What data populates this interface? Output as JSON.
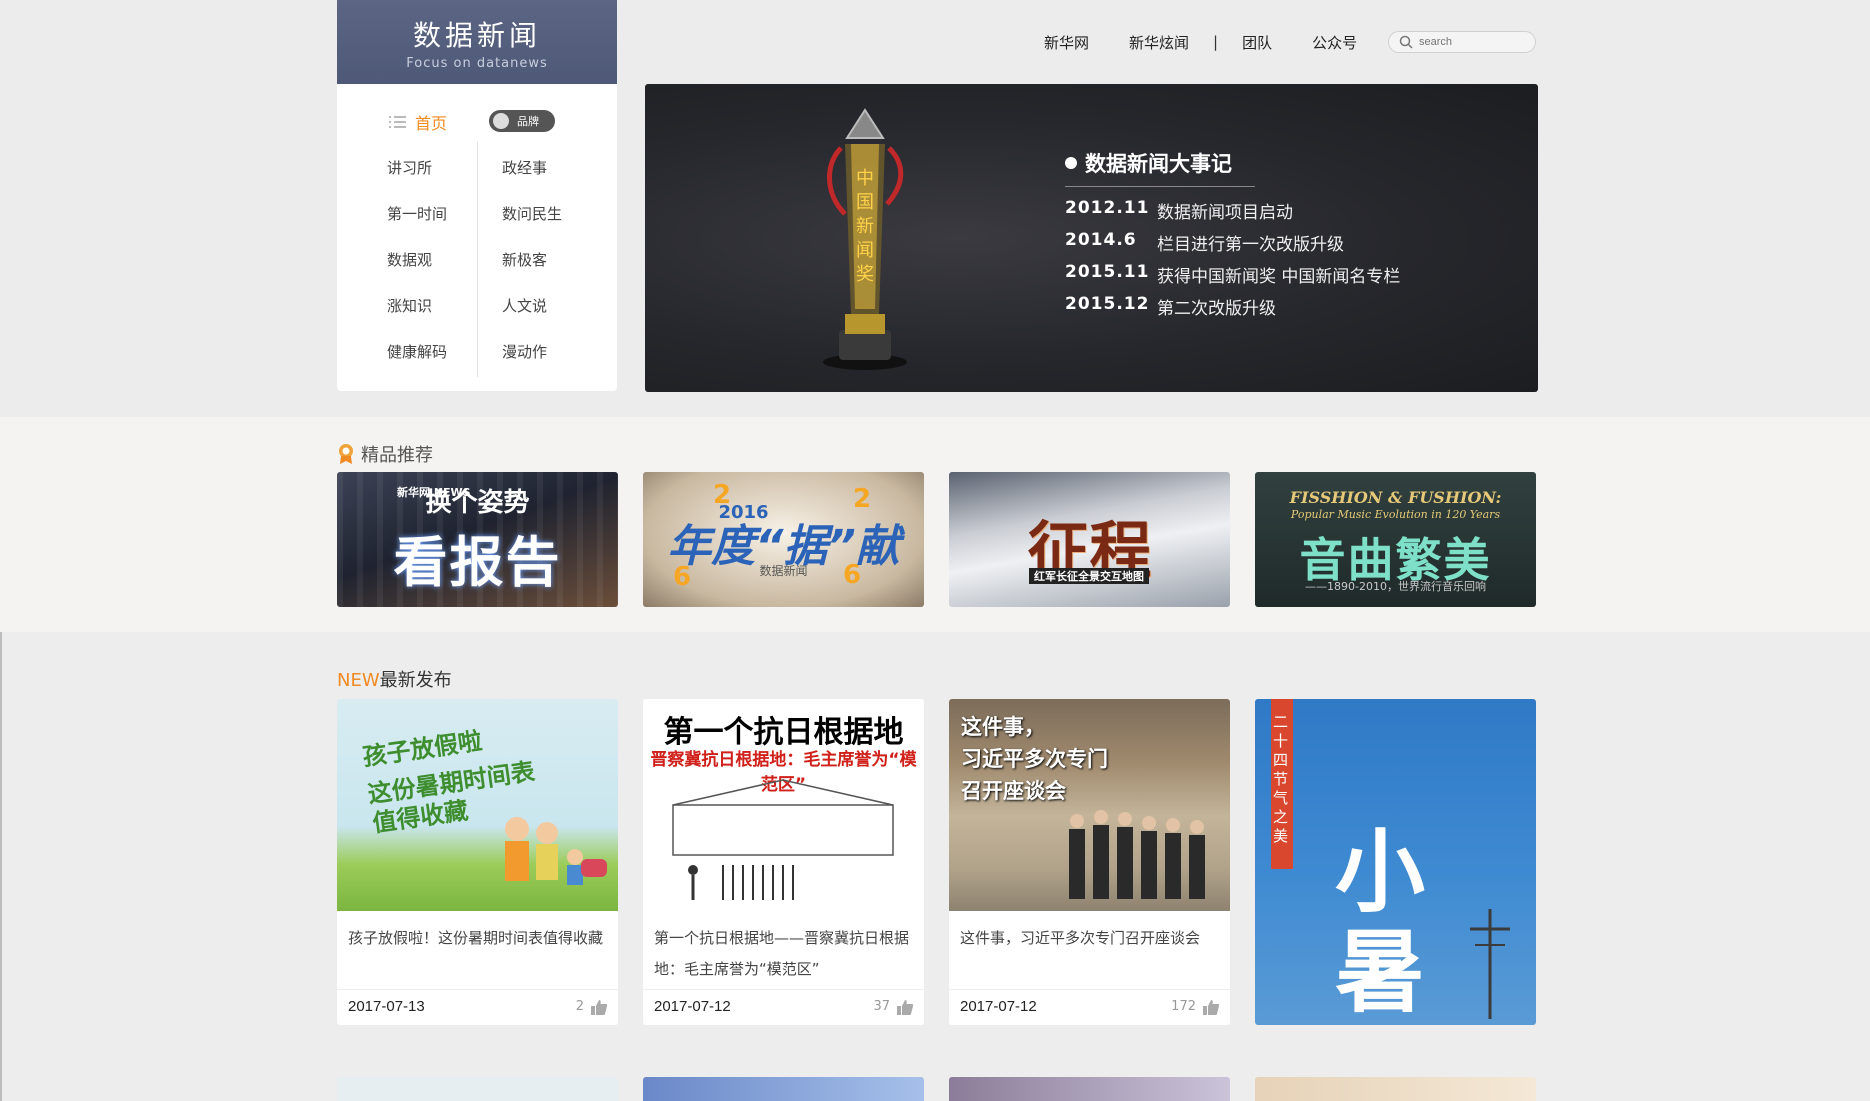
{
  "header": {
    "logo_cn": "数据新闻",
    "logo_en": "Focus on datanews",
    "nav": [
      "新华网",
      "新华炫闻",
      "团队",
      "公众号"
    ],
    "separator": "|",
    "search_placeholder": "search"
  },
  "menu": {
    "home": "首页",
    "toggle_label": "品牌",
    "left": [
      "讲习所",
      "第一时间",
      "数据观",
      "涨知识",
      "健康解码"
    ],
    "right": [
      "政经事",
      "数问民生",
      "新极客",
      "人文说",
      "漫动作"
    ]
  },
  "banner": {
    "title": "数据新闻大事记",
    "trophy_text": "中国新闻奖",
    "events": [
      {
        "year": "2012.11",
        "text": "数据新闻项目启动"
      },
      {
        "year": "2014.6",
        "text": "栏目进行第一次改版升级"
      },
      {
        "year": "2015.11",
        "text": "获得中国新闻奖 中国新闻名专栏"
      },
      {
        "year": "2015.12",
        "text": "第二次改版升级"
      }
    ]
  },
  "featured": {
    "title": "精品推荐",
    "items": [
      {
        "line1": "换个姿势",
        "line2": "看报告",
        "badge": "新华网 NEWS"
      },
      {
        "line1": "2016",
        "line2": "年度“据”献",
        "line3": "数据新闻"
      },
      {
        "line1": "征程",
        "line2": "红军长征全景交互地图"
      },
      {
        "line1": "FISSHION & FUSHION:",
        "line2": "Popular Music Evolution in 120 Years",
        "line3": "音曲繁美",
        "line4": "——1890-2010，世界流行音乐回响"
      }
    ]
  },
  "latest": {
    "new_label": "NEW",
    "title": "最新发布",
    "cards": [
      {
        "img_lines": [
          "孩子放假啦",
          "这份暑期时间表",
          "值得收藏"
        ],
        "title": "孩子放假啦！这份暑期时间表值得收藏",
        "date": "2017-07-13",
        "likes": "2"
      },
      {
        "img_lines": [
          "第一个抗日根据地",
          "晋察冀抗日根据地：毛主席誉为“模范区”"
        ],
        "title": "第一个抗日根据地——晋察冀抗日根据地：毛主席誉为“模范区”",
        "date": "2017-07-12",
        "likes": "37"
      },
      {
        "img_lines": [
          "这件事，",
          "习近平多次专门",
          "召开座谈会"
        ],
        "title": "这件事，习近平多次专门召开座谈会",
        "date": "2017-07-12",
        "likes": "172"
      },
      {
        "img_lines": [
          "二十四节气之美",
          "小",
          "暑"
        ]
      }
    ]
  },
  "colors": {
    "accent": "#f08a24",
    "logo_bg": "#56607e",
    "banner_bg": "#26272c"
  }
}
